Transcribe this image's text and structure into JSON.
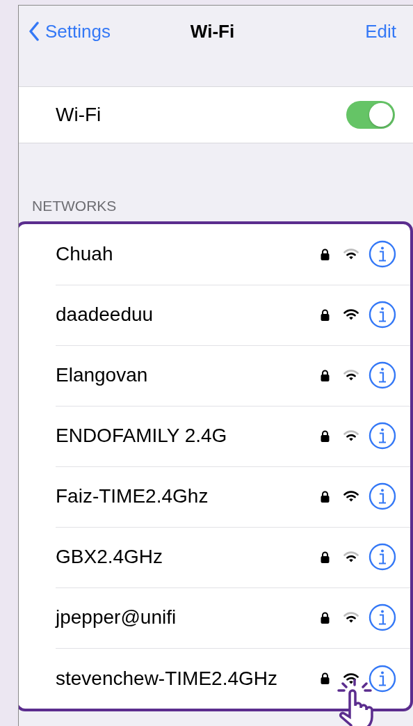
{
  "nav": {
    "back": "Settings",
    "title": "Wi-Fi",
    "action": "Edit"
  },
  "wifi": {
    "label": "Wi-Fi",
    "on": true
  },
  "networks_header": "NETWORKS",
  "networks": [
    {
      "name": "Chuah",
      "locked": true,
      "strong_signal": false
    },
    {
      "name": "daadeeduu",
      "locked": true,
      "strong_signal": true
    },
    {
      "name": "Elangovan",
      "locked": true,
      "strong_signal": false
    },
    {
      "name": "ENDOFAMILY 2.4G",
      "locked": true,
      "strong_signal": false
    },
    {
      "name": "Faiz-TIME2.4Ghz",
      "locked": true,
      "strong_signal": true
    },
    {
      "name": "GBX2.4GHz",
      "locked": true,
      "strong_signal": false
    },
    {
      "name": "jpepper@unifi",
      "locked": true,
      "strong_signal": false
    },
    {
      "name": "stevenchew-TIME2.4GHz",
      "locked": true,
      "strong_signal": true
    }
  ]
}
